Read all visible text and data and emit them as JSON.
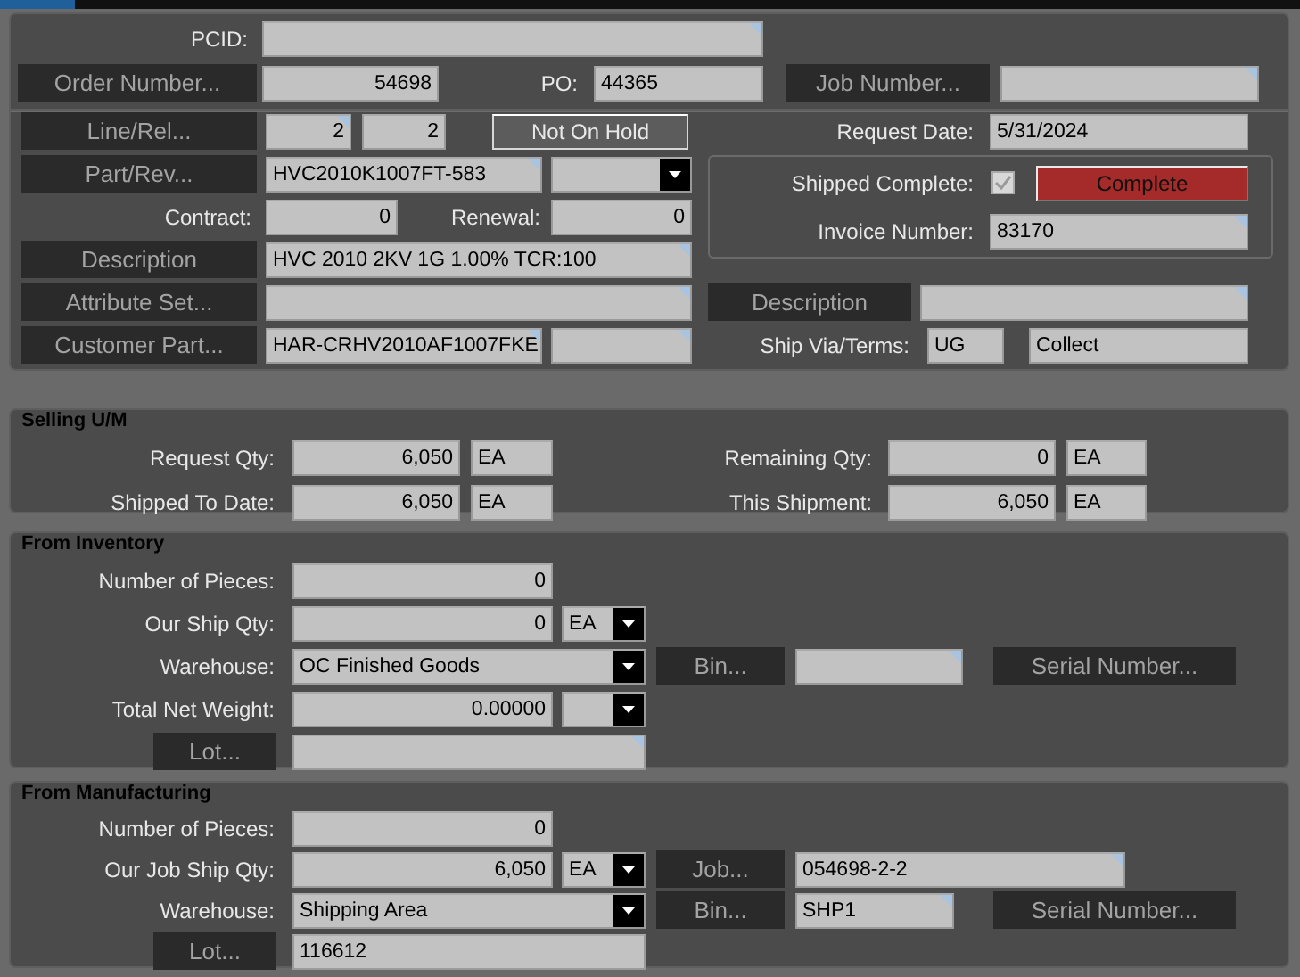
{
  "header": {
    "rows": [
      [
        {
          "kind": "label",
          "text": "PCID:"
        },
        {
          "kind": "field",
          "lookup": true
        }
      ],
      [
        {
          "kind": "button",
          "text": "Order Number..."
        },
        {
          "kind": "field",
          "value": "54698"
        },
        {
          "kind": "label",
          "text": "PO:"
        },
        {
          "kind": "field",
          "value": "44365"
        },
        {
          "kind": "button",
          "text": "Job Number..."
        },
        {
          "kind": "field",
          "lookup": true
        }
      ]
    ]
  },
  "line_item": {
    "rows": [
      {
        "items": [
          {
            "kind": "button",
            "text": "Line/Rel..."
          },
          {
            "kind": "field",
            "value": "2",
            "lookup": true
          },
          {
            "kind": "field",
            "value": "2"
          },
          {
            "kind": "toggle",
            "text": "Not On Hold"
          }
        ]
      },
      {
        "items": [
          {
            "kind": "button",
            "text": "Part/Rev..."
          },
          {
            "kind": "field",
            "value": "HVC2010K1007FT-583",
            "lookup": true
          },
          {
            "kind": "select"
          }
        ]
      },
      {
        "items": [
          {
            "kind": "label",
            "text": "Contract:"
          },
          {
            "kind": "field",
            "value": "0"
          },
          {
            "kind": "label",
            "text": "Renewal:"
          },
          {
            "kind": "field",
            "value": "0"
          }
        ]
      },
      {
        "items": [
          {
            "kind": "button",
            "text": "Description"
          },
          {
            "kind": "field",
            "value": "HVC 2010 2KV 1G 1.00% TCR:100",
            "lookup": true
          }
        ]
      },
      {
        "items": [
          {
            "kind": "button",
            "text": "Attribute Set..."
          },
          {
            "kind": "field",
            "lookup": true
          }
        ]
      },
      {
        "items": [
          {
            "kind": "button",
            "text": "Customer Part..."
          },
          {
            "kind": "field",
            "value": "HAR-CRHV2010AF1007FKE",
            "lookup": true
          },
          {
            "kind": "field",
            "lookup": true
          }
        ]
      }
    ],
    "side_top": [
      [
        {
          "kind": "label",
          "text": "Request Date:"
        },
        {
          "kind": "field",
          "value": "5/31/2024"
        }
      ]
    ],
    "shipment": [
      [
        {
          "kind": "label",
          "text": "Shipped Complete:"
        },
        {
          "kind": "check",
          "checked": true,
          "disabled": true
        },
        {
          "kind": "alert",
          "text": "Complete",
          "color": "#a52a2a"
        }
      ],
      [
        {
          "kind": "label",
          "text": "Invoice Number:"
        },
        {
          "kind": "field",
          "value": "83170",
          "lookup": true
        }
      ]
    ],
    "side_bottom": [
      [
        {
          "kind": "button",
          "text": "Description"
        },
        {
          "kind": "field",
          "lookup": true
        }
      ],
      [
        {
          "kind": "label",
          "text": "Ship Via/Terms:"
        },
        {
          "kind": "field",
          "value": "UG"
        },
        {
          "kind": "field",
          "value": "Collect"
        }
      ]
    ]
  },
  "selling_um": {
    "title": "Selling U/M",
    "rows": [
      [
        {
          "kind": "label",
          "text": "Request Qty:"
        },
        {
          "kind": "field",
          "value": "6,050"
        },
        {
          "kind": "field",
          "value": "EA"
        },
        {
          "kind": "label",
          "text": "Remaining Qty:"
        },
        {
          "kind": "field",
          "value": "0"
        },
        {
          "kind": "field",
          "value": "EA"
        }
      ],
      [
        {
          "kind": "label",
          "text": "Shipped To Date:"
        },
        {
          "kind": "field",
          "value": "6,050"
        },
        {
          "kind": "field",
          "value": "EA"
        },
        {
          "kind": "label",
          "text": "This Shipment:"
        },
        {
          "kind": "field",
          "value": "6,050"
        },
        {
          "kind": "field",
          "value": "EA"
        }
      ]
    ]
  },
  "from_inventory": {
    "title": "From Inventory",
    "rows": [
      {
        "items": [
          {
            "kind": "label",
            "text": "Number of Pieces:"
          },
          {
            "kind": "field",
            "value": "0"
          }
        ]
      },
      {
        "items": [
          {
            "kind": "label",
            "text": "Our Ship Qty:"
          },
          {
            "kind": "field",
            "value": "0"
          },
          {
            "kind": "select",
            "value": "EA"
          }
        ]
      },
      {
        "items": [
          {
            "kind": "label",
            "text": "Warehouse:"
          },
          {
            "kind": "select",
            "value": "OC Finished Goods"
          },
          {
            "kind": "button",
            "text": "Bin..."
          },
          {
            "kind": "field",
            "lookup": true
          },
          {
            "kind": "button",
            "text": "Serial Number..."
          }
        ]
      },
      {
        "items": [
          {
            "kind": "label",
            "text": "Total Net Weight:"
          },
          {
            "kind": "field",
            "value": "0.00000"
          },
          {
            "kind": "select"
          }
        ]
      },
      {
        "items": [
          {
            "kind": "button",
            "text": "Lot..."
          },
          {
            "kind": "field",
            "lookup": true
          }
        ]
      }
    ]
  },
  "from_manufacturing": {
    "title": "From Manufacturing",
    "rows": [
      {
        "items": [
          {
            "kind": "label",
            "text": "Number of Pieces:"
          },
          {
            "kind": "field",
            "value": "0"
          }
        ]
      },
      {
        "items": [
          {
            "kind": "label",
            "text": "Our Job Ship Qty:"
          },
          {
            "kind": "field",
            "value": "6,050"
          },
          {
            "kind": "select",
            "value": "EA"
          },
          {
            "kind": "button",
            "text": "Job..."
          },
          {
            "kind": "field",
            "value": "054698-2-2",
            "lookup": true
          }
        ]
      },
      {
        "items": [
          {
            "kind": "label",
            "text": "Warehouse:"
          },
          {
            "kind": "select",
            "value": "Shipping Area"
          },
          {
            "kind": "button",
            "text": "Bin..."
          },
          {
            "kind": "field",
            "value": "SHP1",
            "lookup": true
          },
          {
            "kind": "button",
            "text": "Serial Number..."
          }
        ]
      },
      {
        "items": [
          {
            "kind": "button",
            "text": "Lot..."
          },
          {
            "kind": "field",
            "value": "116612"
          }
        ]
      }
    ]
  }
}
